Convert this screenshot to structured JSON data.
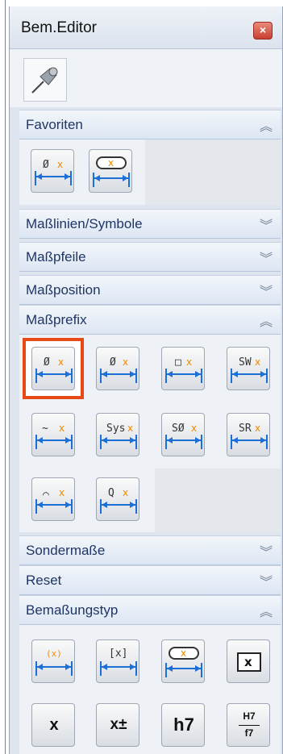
{
  "window": {
    "title": "Bem.Editor",
    "close_label": "×"
  },
  "sections": [
    {
      "label": "Favoriten",
      "chevron": "︽"
    },
    {
      "label": "Maßlinien/Symbole",
      "chevron": "︾"
    },
    {
      "label": "Maßpfeile",
      "chevron": "︾"
    },
    {
      "label": "Maßposition",
      "chevron": "︾"
    },
    {
      "label": "Maßprefix",
      "chevron": "︽"
    },
    {
      "label": "Sondermaße",
      "chevron": "︾"
    },
    {
      "label": "Reset",
      "chevron": "︾"
    },
    {
      "label": "Bemaßungstyp",
      "chevron": "︽"
    }
  ],
  "prefix_buttons": [
    "Ø",
    "Ø",
    "□",
    "SW",
    "~",
    "Sys",
    "SØ",
    "SR",
    "⌒",
    "Q"
  ],
  "type_buttons": [
    "(x)",
    "[x]",
    "x",
    "x",
    "x",
    "x±",
    "h7",
    "H7",
    "f7"
  ],
  "colors": {
    "accent": "#e84a17",
    "header_text": "#1f3564",
    "arrow": "#1b6fd6",
    "marker": "#f08a00"
  }
}
